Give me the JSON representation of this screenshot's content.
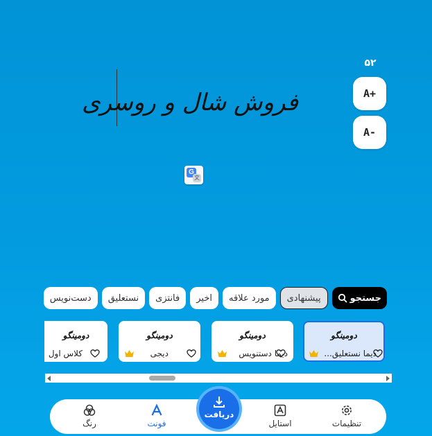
{
  "size": {
    "value": "۵۲",
    "increase_label": "A+",
    "decrease_label": "A-"
  },
  "preview": {
    "text": "فروش شال و روسری"
  },
  "translate_icon": {
    "g": "G",
    "x": "文"
  },
  "chips": {
    "search_label": "جستجو",
    "items": [
      "پیشنهادی",
      "مورد علاقه",
      "اخیر",
      "فانتزی",
      "نستعلیق",
      "دست‌نویس"
    ],
    "active": "پیشنهادی"
  },
  "fonts": [
    {
      "sample": "دومینگو",
      "name": "دیما نستعلیق...",
      "premium": true,
      "selected": true
    },
    {
      "sample": "دومینگو",
      "name": "دیما دستنویس",
      "premium": true,
      "selected": false
    },
    {
      "sample": "دومینگو",
      "name": "دیجی",
      "premium": true,
      "selected": false
    },
    {
      "sample": "دومینگو",
      "name": "کلاس اول",
      "premium": false,
      "selected": false
    }
  ],
  "nav": {
    "settings": "تنظیمات",
    "style": "استایل",
    "download": "دریافت",
    "font": "فونت",
    "color": "رنگ"
  },
  "colors": {
    "accent": "#1a6ee8",
    "background": "#039be0",
    "crown": "#f2b400"
  }
}
